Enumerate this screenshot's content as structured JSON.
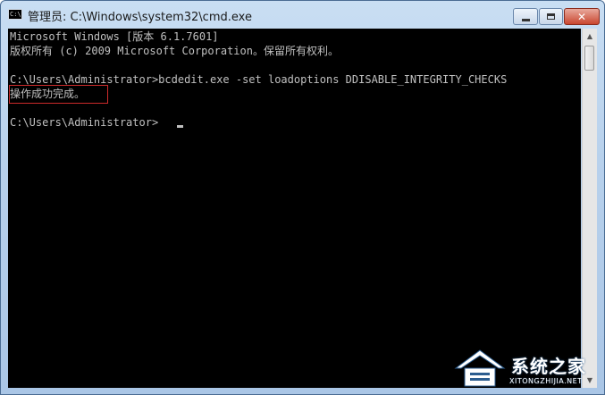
{
  "window": {
    "title": "管理员: C:\\Windows\\system32\\cmd.exe",
    "icon_label": "C:\\"
  },
  "console": {
    "lines": [
      "Microsoft Windows [版本 6.1.7601]",
      "版权所有 (c) 2009 Microsoft Corporation。保留所有权利。",
      "",
      "C:\\Users\\Administrator>bcdedit.exe -set loadoptions DDISABLE_INTEGRITY_CHECKS",
      "操作成功完成。",
      "",
      "C:\\Users\\Administrator>"
    ],
    "text_color": "#c0c0c0",
    "background": "#000000",
    "highlight_color": "#cc2b2b"
  },
  "watermark": {
    "text": "系统之家",
    "subtext": "XITONGZHIJIA.NET"
  }
}
